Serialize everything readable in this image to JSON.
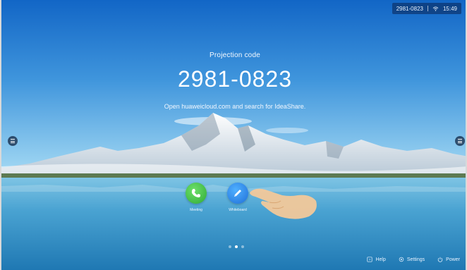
{
  "status": {
    "code": "2981-0823",
    "time": "15:49",
    "icons": {
      "network": "wifi-icon"
    }
  },
  "projection": {
    "label": "Projection code",
    "code": "2981-0823",
    "hint": "Open huaweicloud.com and search for IdeaShare."
  },
  "apps": [
    {
      "label": "Meeting",
      "icon": "phone-icon"
    },
    {
      "label": "Whiteboard",
      "icon": "pen-icon"
    }
  ],
  "pager": {
    "pages": 3,
    "active": 2
  },
  "bottom_bar": {
    "help": "Help",
    "settings": "Settings",
    "power": "Power"
  },
  "colors": {
    "sky_top": "#1469c8",
    "sky_bottom": "#8fd0f2",
    "water": "#3d98c9",
    "meeting": "#3bbf3c",
    "whiteboard": "#2a86e8"
  }
}
